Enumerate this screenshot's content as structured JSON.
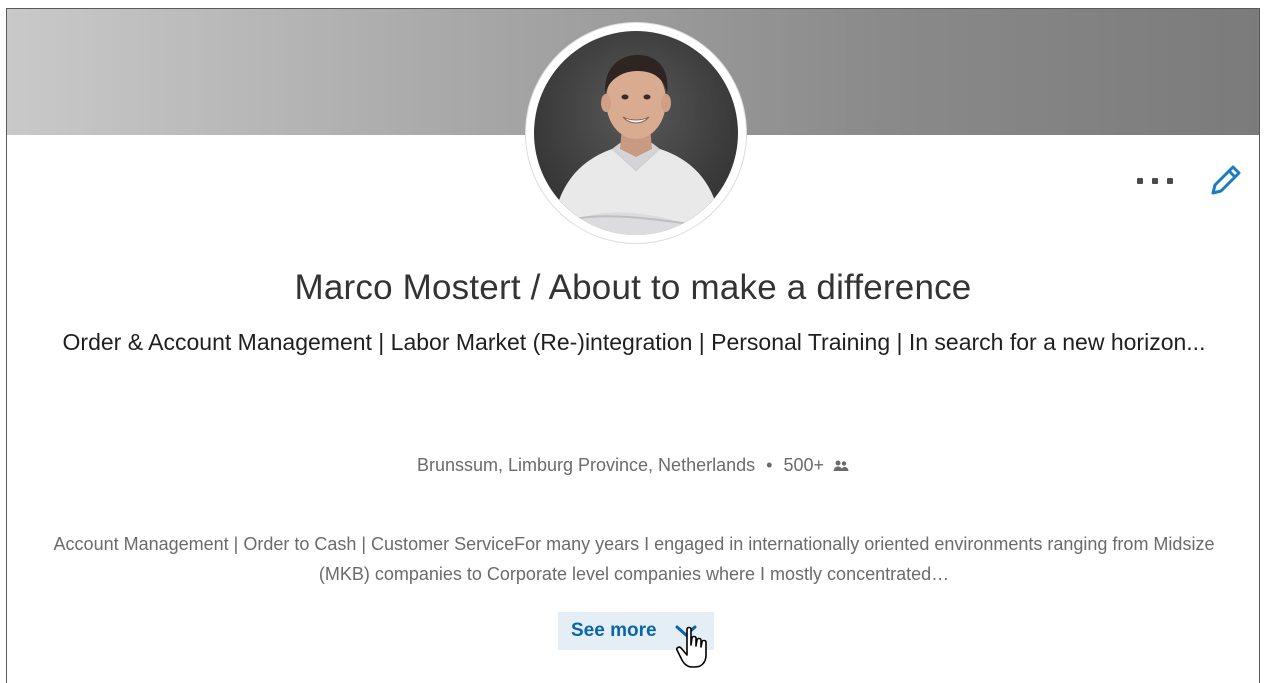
{
  "profile": {
    "name": "Marco Mostert / About to make a difference",
    "headline": "Order & Account Management | Labor Market (Re-)integration | Personal Training | In search for a new horizon...",
    "location": "Brunssum, Limburg Province, Netherlands",
    "separator": "•",
    "connections": "500+",
    "summary": "Account Management | Order to Cash | Customer ServiceFor many years I engaged in internationally oriented environments ranging from Midsize (MKB) companies to Corporate level companies where I mostly concentrated…"
  },
  "actions": {
    "more_icon": "ellipsis-icon",
    "edit_icon": "pencil-icon",
    "see_more_label": "See more",
    "see_more_icon": "chevron-down-icon"
  },
  "colors": {
    "accent": "#0a66a8",
    "see_more_bg": "#e6eef5",
    "edit_icon": "#1c7cc0"
  }
}
